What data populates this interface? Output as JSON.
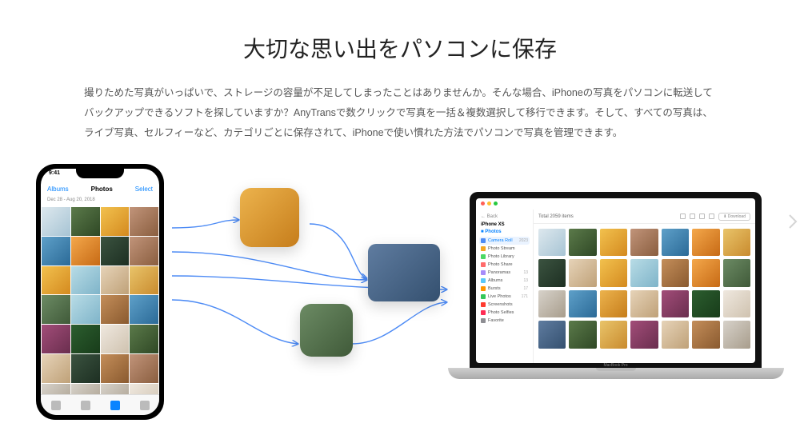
{
  "header": {
    "title": "大切な思い出をパソコンに保存",
    "description": "撮りためた写真がいっぱいで、ストレージの容量が不足してしまったことはありませんか。そんな場合、iPhoneの写真をパソコンに転送してバックアップできるソフトを探していますか？AnyTransで数クリックで写真を一括＆複数選択して移行できます。そして、すべての写真は、ライブ写真、セルフィーなど、カテゴリごとに保存されて、iPhoneで使い慣れた方法でパソコンで写真を管理できます。"
  },
  "phone": {
    "time": "9:41",
    "back": "Albums",
    "title": "Photos",
    "select": "Select",
    "date": "Dec 28 - Aug 20, 2018",
    "thumbs": [
      "c0",
      "c1",
      "c2",
      "c3",
      "c4",
      "c5",
      "c6",
      "c3",
      "c2",
      "c8",
      "c7",
      "c15",
      "c17",
      "c8",
      "c9",
      "c4",
      "c10",
      "c12",
      "c11",
      "c1",
      "c7",
      "c6",
      "c9",
      "c3",
      "c13",
      "c13",
      "c13",
      "c11"
    ]
  },
  "mac": {
    "label": "MacBook Pro",
    "back": "← Back",
    "device": "iPhone XS",
    "section": "Photos",
    "total": "Total 2059 items",
    "download_btn": "Download",
    "sidebar": [
      {
        "icon": "#4d8bf5",
        "label": "Camera Roll",
        "count": "2023",
        "active": true
      },
      {
        "icon": "#f5a623",
        "label": "Photo Stream",
        "count": ""
      },
      {
        "icon": "#4cd964",
        "label": "Photo Library",
        "count": ""
      },
      {
        "icon": "#ff6b6b",
        "label": "Photo Share",
        "count": ""
      },
      {
        "icon": "#a78bfa",
        "label": "Panoramas",
        "count": "13"
      },
      {
        "icon": "#5ac8fa",
        "label": "Albums",
        "count": "13"
      },
      {
        "icon": "#ff9500",
        "label": "Bursts",
        "count": "17"
      },
      {
        "icon": "#34c759",
        "label": "Live Photos",
        "count": "171"
      },
      {
        "icon": "#ff3b30",
        "label": "Screenshots",
        "count": ""
      },
      {
        "icon": "#ff2d55",
        "label": "Photo Selfies",
        "count": ""
      },
      {
        "icon": "#8e8e93",
        "label": "Favorite",
        "count": ""
      }
    ],
    "grid": [
      "c0",
      "c1",
      "c2",
      "c3",
      "c4",
      "c5",
      "c15",
      "c6",
      "c7",
      "c2",
      "c8",
      "c9",
      "c5",
      "c17",
      "c13",
      "c4",
      "c16",
      "c7",
      "c10",
      "c12",
      "c11",
      "c14",
      "c1",
      "c15",
      "c10",
      "c7",
      "c9",
      "c13"
    ]
  },
  "floats": {
    "f1": "c16",
    "f2": "c14",
    "f3": "c17"
  }
}
